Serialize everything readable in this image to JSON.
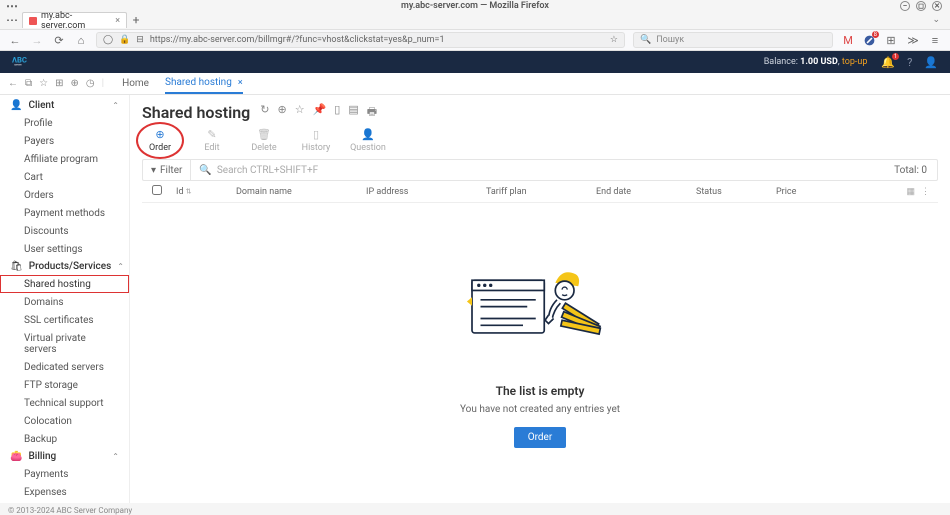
{
  "os": {
    "window_title": "my.abc-server.com — Mozilla Firefox"
  },
  "browser": {
    "tab_title": "my.abc-server.com",
    "url": "https://my.abc-server.com/billmgr#/?func=vhost&clickstat=yes&p_num=1",
    "search_placeholder": "Пошук"
  },
  "header": {
    "balance_label": "Balance:",
    "balance_value": "1.00 USD",
    "topup": "top-up",
    "notif_count": "1"
  },
  "nav": {
    "home": "Home",
    "shared_hosting": "Shared hosting"
  },
  "sidebar": {
    "client": "Client",
    "client_items": [
      "Profile",
      "Payers",
      "Affiliate program",
      "Cart",
      "Orders",
      "Payment methods",
      "Discounts",
      "User settings"
    ],
    "products": "Products/Services",
    "products_items": [
      "Shared hosting",
      "Domains",
      "SSL certificates",
      "Virtual private servers",
      "Dedicated servers",
      "FTP storage",
      "Technical support",
      "Colocation",
      "Backup"
    ],
    "billing": "Billing",
    "billing_items": [
      "Payments",
      "Expenses"
    ]
  },
  "page": {
    "title": "Shared hosting",
    "toolbar": {
      "order": "Order",
      "edit": "Edit",
      "delete": "Delete",
      "history": "History",
      "question": "Question"
    },
    "filter_label": "Filter",
    "filter_search": "Search CTRL+SHIFT+F",
    "total_label": "Total: 0",
    "cols": {
      "id": "Id",
      "domain": "Domain name",
      "ip": "IP address",
      "tariff": "Tariff plan",
      "end": "End date",
      "status": "Status",
      "price": "Price"
    },
    "empty_title": "The list is empty",
    "empty_sub": "You have not created any entries yet",
    "order_btn": "Order"
  },
  "footer": "© 2013-2024 ABC Server Company"
}
